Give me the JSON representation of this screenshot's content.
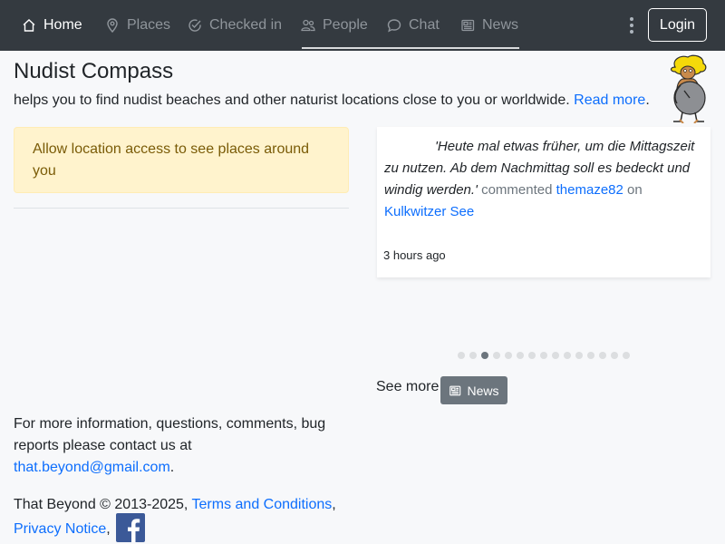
{
  "navbar": {
    "items": [
      {
        "label": "Home",
        "icon": "home-icon",
        "active": true
      },
      {
        "label": "Places",
        "icon": "map-pin-icon",
        "active": false
      },
      {
        "label": "Checked in",
        "icon": "check-circle-icon",
        "active": false
      },
      {
        "label": "People",
        "icon": "people-icon",
        "active": false
      },
      {
        "label": "Chat",
        "icon": "chat-bubble-icon",
        "active": false
      },
      {
        "label": "News",
        "icon": "newspaper-icon",
        "active": false
      }
    ],
    "menu_icon": "kebab-menu-icon",
    "login_label": "Login"
  },
  "header": {
    "title": "Nudist Compass",
    "subtitle": "helps you to find nudist beaches and other naturist locations close to you or worldwide.",
    "read_more": "Read more",
    "period": "."
  },
  "location_alert": {
    "text": "Allow location access to see places around you"
  },
  "news_card": {
    "quote": "'Heute mal etwas früher, um die Mittagszeit zu nutzen. Ab dem Nachmittag soll es bedeckt und windig werden.'",
    "action": "commented",
    "user": "themaze82",
    "on": "on",
    "place": "Kulkwitzer See",
    "time": "3 hours ago"
  },
  "carousel": {
    "count": 15,
    "active_index": 2
  },
  "see_more": {
    "label": "See more",
    "button_label": "News"
  },
  "footer": {
    "info_text": "For more information, questions, comments, bug reports please contact us at",
    "email": "that.beyond@gmail.com",
    "info_end": ".",
    "copyright": "That Beyond © 2013-2025,",
    "terms": "Terms and Conditions",
    "comma": ",",
    "privacy": "Privacy Notice",
    "comma2": ","
  },
  "colors": {
    "navbar_bg": "#343a40",
    "link": "#0d6efd",
    "alert_bg": "#fff3cd",
    "alert_text": "#7a5b07",
    "button_secondary": "#6c757d",
    "facebook": "#3b5998"
  }
}
